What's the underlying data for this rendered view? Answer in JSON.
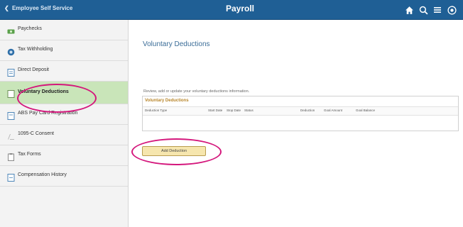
{
  "header": {
    "back_label": "Employee Self Service",
    "title": "Payroll",
    "icons": [
      "home-icon",
      "search-icon",
      "menu-icon",
      "navbar-icon"
    ]
  },
  "sidebar": {
    "items": [
      {
        "label": "Paychecks",
        "icon": "money-icon",
        "active": false
      },
      {
        "label": "Tax Withholding",
        "icon": "tax-icon",
        "active": false
      },
      {
        "label": "Direct Deposit",
        "icon": "deposit-icon",
        "active": false
      },
      {
        "label": "Voluntary Deductions",
        "icon": "deductions-icon",
        "active": true
      },
      {
        "label": "ABS Pay Card Registration",
        "icon": "card-icon",
        "active": false
      },
      {
        "label": "1095-C Consent",
        "icon": "consent-icon",
        "active": false
      },
      {
        "label": "Tax Forms",
        "icon": "forms-icon",
        "active": false
      },
      {
        "label": "Compensation History",
        "icon": "history-icon",
        "active": false
      }
    ]
  },
  "main": {
    "page_title": "Voluntary Deductions",
    "instructions": "Review, add or update your voluntary deductions information.",
    "grid": {
      "caption": "Voluntary Deductions",
      "columns": [
        "Deduction Type",
        "Start Date",
        "Stop Date",
        "Status",
        "Deduction",
        "Goal Amount",
        "Goal Balance"
      ]
    },
    "add_button": "Add Deduction"
  },
  "colors": {
    "header_bg": "#1f5f95",
    "active_bg": "#c9e5b9",
    "annotation": "#d4177c",
    "button_bg": "#f6e6ae"
  }
}
